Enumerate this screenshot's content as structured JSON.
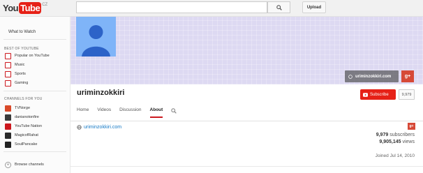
{
  "masthead": {
    "logo_you": "You",
    "logo_tube": "Tube",
    "logo_country": "CZ",
    "search_placeholder": "",
    "upload_label": "Upload"
  },
  "sidebar": {
    "what_to_watch": "What to Watch",
    "best_of_title": "BEST OF YOUTUBE",
    "best_of": [
      {
        "label": "Popular on YouTube",
        "icon": "popular-icon",
        "color": "#cc181e"
      },
      {
        "label": "Music",
        "icon": "music-icon",
        "color": "#cc181e"
      },
      {
        "label": "Sports",
        "icon": "sports-icon",
        "color": "#cc181e"
      },
      {
        "label": "Gaming",
        "icon": "gaming-icon",
        "color": "#cc181e"
      }
    ],
    "channels_title": "CHANNELS FOR YOU",
    "channels": [
      {
        "label": "TVNorge",
        "color": "#d94a2a"
      },
      {
        "label": "danianotonfire",
        "color": "#3b3b3b"
      },
      {
        "label": "YouTube Nation",
        "color": "#cc181e"
      },
      {
        "label": "MagicofRahat",
        "color": "#2b2b2b"
      },
      {
        "label": "SoulPancake",
        "color": "#222222"
      }
    ],
    "browse_channels": "Browse channels"
  },
  "banner": {
    "link_label": "uriminzokkiri.com",
    "gplus_label": "g+"
  },
  "channel": {
    "title": "uriminzokkiri",
    "subscribe_label": "Subscribe",
    "subscriber_count_short": "9,979",
    "tabs": [
      {
        "label": "Home",
        "active": false
      },
      {
        "label": "Videos",
        "active": false
      },
      {
        "label": "Discussion",
        "active": false
      },
      {
        "label": "About",
        "active": true
      }
    ]
  },
  "about": {
    "website": "uriminzokkiri.com",
    "gplus_label": "g+",
    "subscribers_value": "9,979",
    "subscribers_label": "subscribers",
    "views_value": "9,905,145",
    "views_label": "views",
    "joined": "Joined Jul 14, 2010"
  },
  "colors": {
    "accent_red": "#e62117",
    "link_blue": "#167ac6",
    "banner": "#ddd9f2",
    "avatar": "#7fb4f8"
  }
}
